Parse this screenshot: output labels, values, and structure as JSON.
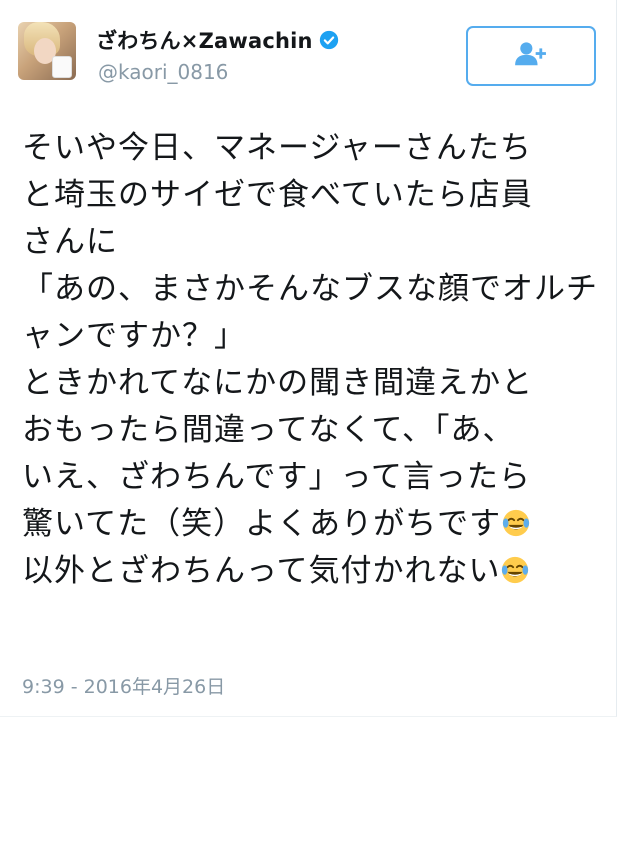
{
  "tweet": {
    "author": {
      "display_name": "ざわちん×Zawachin",
      "handle": "@kaori_0816",
      "verified": true,
      "avatar": "profile-photo"
    },
    "follow_button": {
      "icon": "add-user-icon"
    },
    "lines": [
      "そいや今日、マネージャーさんたち",
      "と埼玉のサイゼで食べていたら店員",
      "さんに",
      "「あの、まさかそんなブスな顔でオルチ",
      "ャンですか？」",
      "ときかれてなにかの聞き間違えかと",
      "おもったら間違ってなくて、「あ、",
      "いえ、ざわちんです」って言ったら",
      "驚いてた（笑）よくありがちです",
      "以外とざわちんって気付かれない"
    ],
    "emojis": {
      "line9": "face-with-tears-of-joy",
      "line10": "face-with-tears-of-joy"
    },
    "timestamp": "9:39 - 2016年4月26日"
  },
  "colors": {
    "accent": "#55acee",
    "verified_badge": "#1da1f2",
    "text": "#14171a",
    "muted": "#8899a6"
  }
}
